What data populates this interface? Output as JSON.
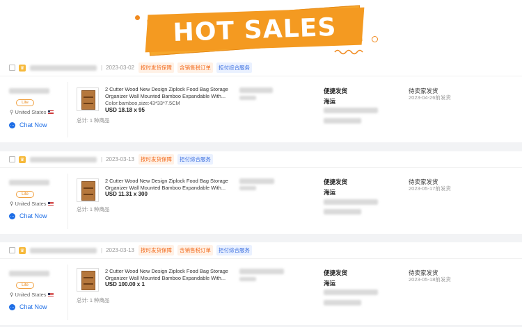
{
  "banner": {
    "title": "HOT SALES"
  },
  "orders": [
    {
      "date": "2023-03-02",
      "tags": [
        "按时发货保障",
        "含销售税订单",
        "拒付综合服务"
      ],
      "seller": {
        "level": "Lite",
        "country": "United States",
        "chat": "Chat Now"
      },
      "product": {
        "title": "2 Cutter Wood New Design Ziplock Food Bag Storage Organizer Wall Mounted Bamboo Expandable With...",
        "attr": "Color:bamboo,size:43*33*7.5CM",
        "price": "USD 18.18 x 95"
      },
      "total": "总计: 1 种商品",
      "ship_type": "便捷发货",
      "ship_method": "海运",
      "status": "待卖家发货",
      "status_date": "2023-04-26前发货"
    },
    {
      "date": "2023-03-13",
      "tags": [
        "按时发货保障",
        "拒付综合服务"
      ],
      "seller": {
        "level": "Lite",
        "country": "United States",
        "chat": "Chat Now"
      },
      "product": {
        "title": "2 Cutter Wood New Design Ziplock Food Bag Storage Organizer Wall Mounted Bamboo Expandable With...",
        "attr": "",
        "price": "USD 11.31 x 300"
      },
      "total": "总计: 1 种商品",
      "ship_type": "便捷发货",
      "ship_method": "海运",
      "status": "待卖家发货",
      "status_date": "2023-05-17前发货"
    },
    {
      "date": "2023-03-13",
      "tags": [
        "按时发货保障",
        "含销售税订单",
        "拒付综合服务"
      ],
      "seller": {
        "level": "Lite",
        "country": "United States",
        "chat": "Chat Now"
      },
      "product": {
        "title": "2 Cutter Wood New Design Ziplock Food Bag Storage Organizer Wall Mounted Bamboo Expandable With...",
        "attr": "",
        "price": "USD 100.00 x 1"
      },
      "total": "总计: 1 种商品",
      "ship_type": "便捷发货",
      "ship_method": "海运",
      "status": "待卖家发货",
      "status_date": "2023-05-18前发货"
    }
  ],
  "colors": {
    "accent": "#f49a21",
    "link": "#1e6ee6",
    "tag_orange": "#f26b1d",
    "tag_blue": "#3b6fe0"
  }
}
